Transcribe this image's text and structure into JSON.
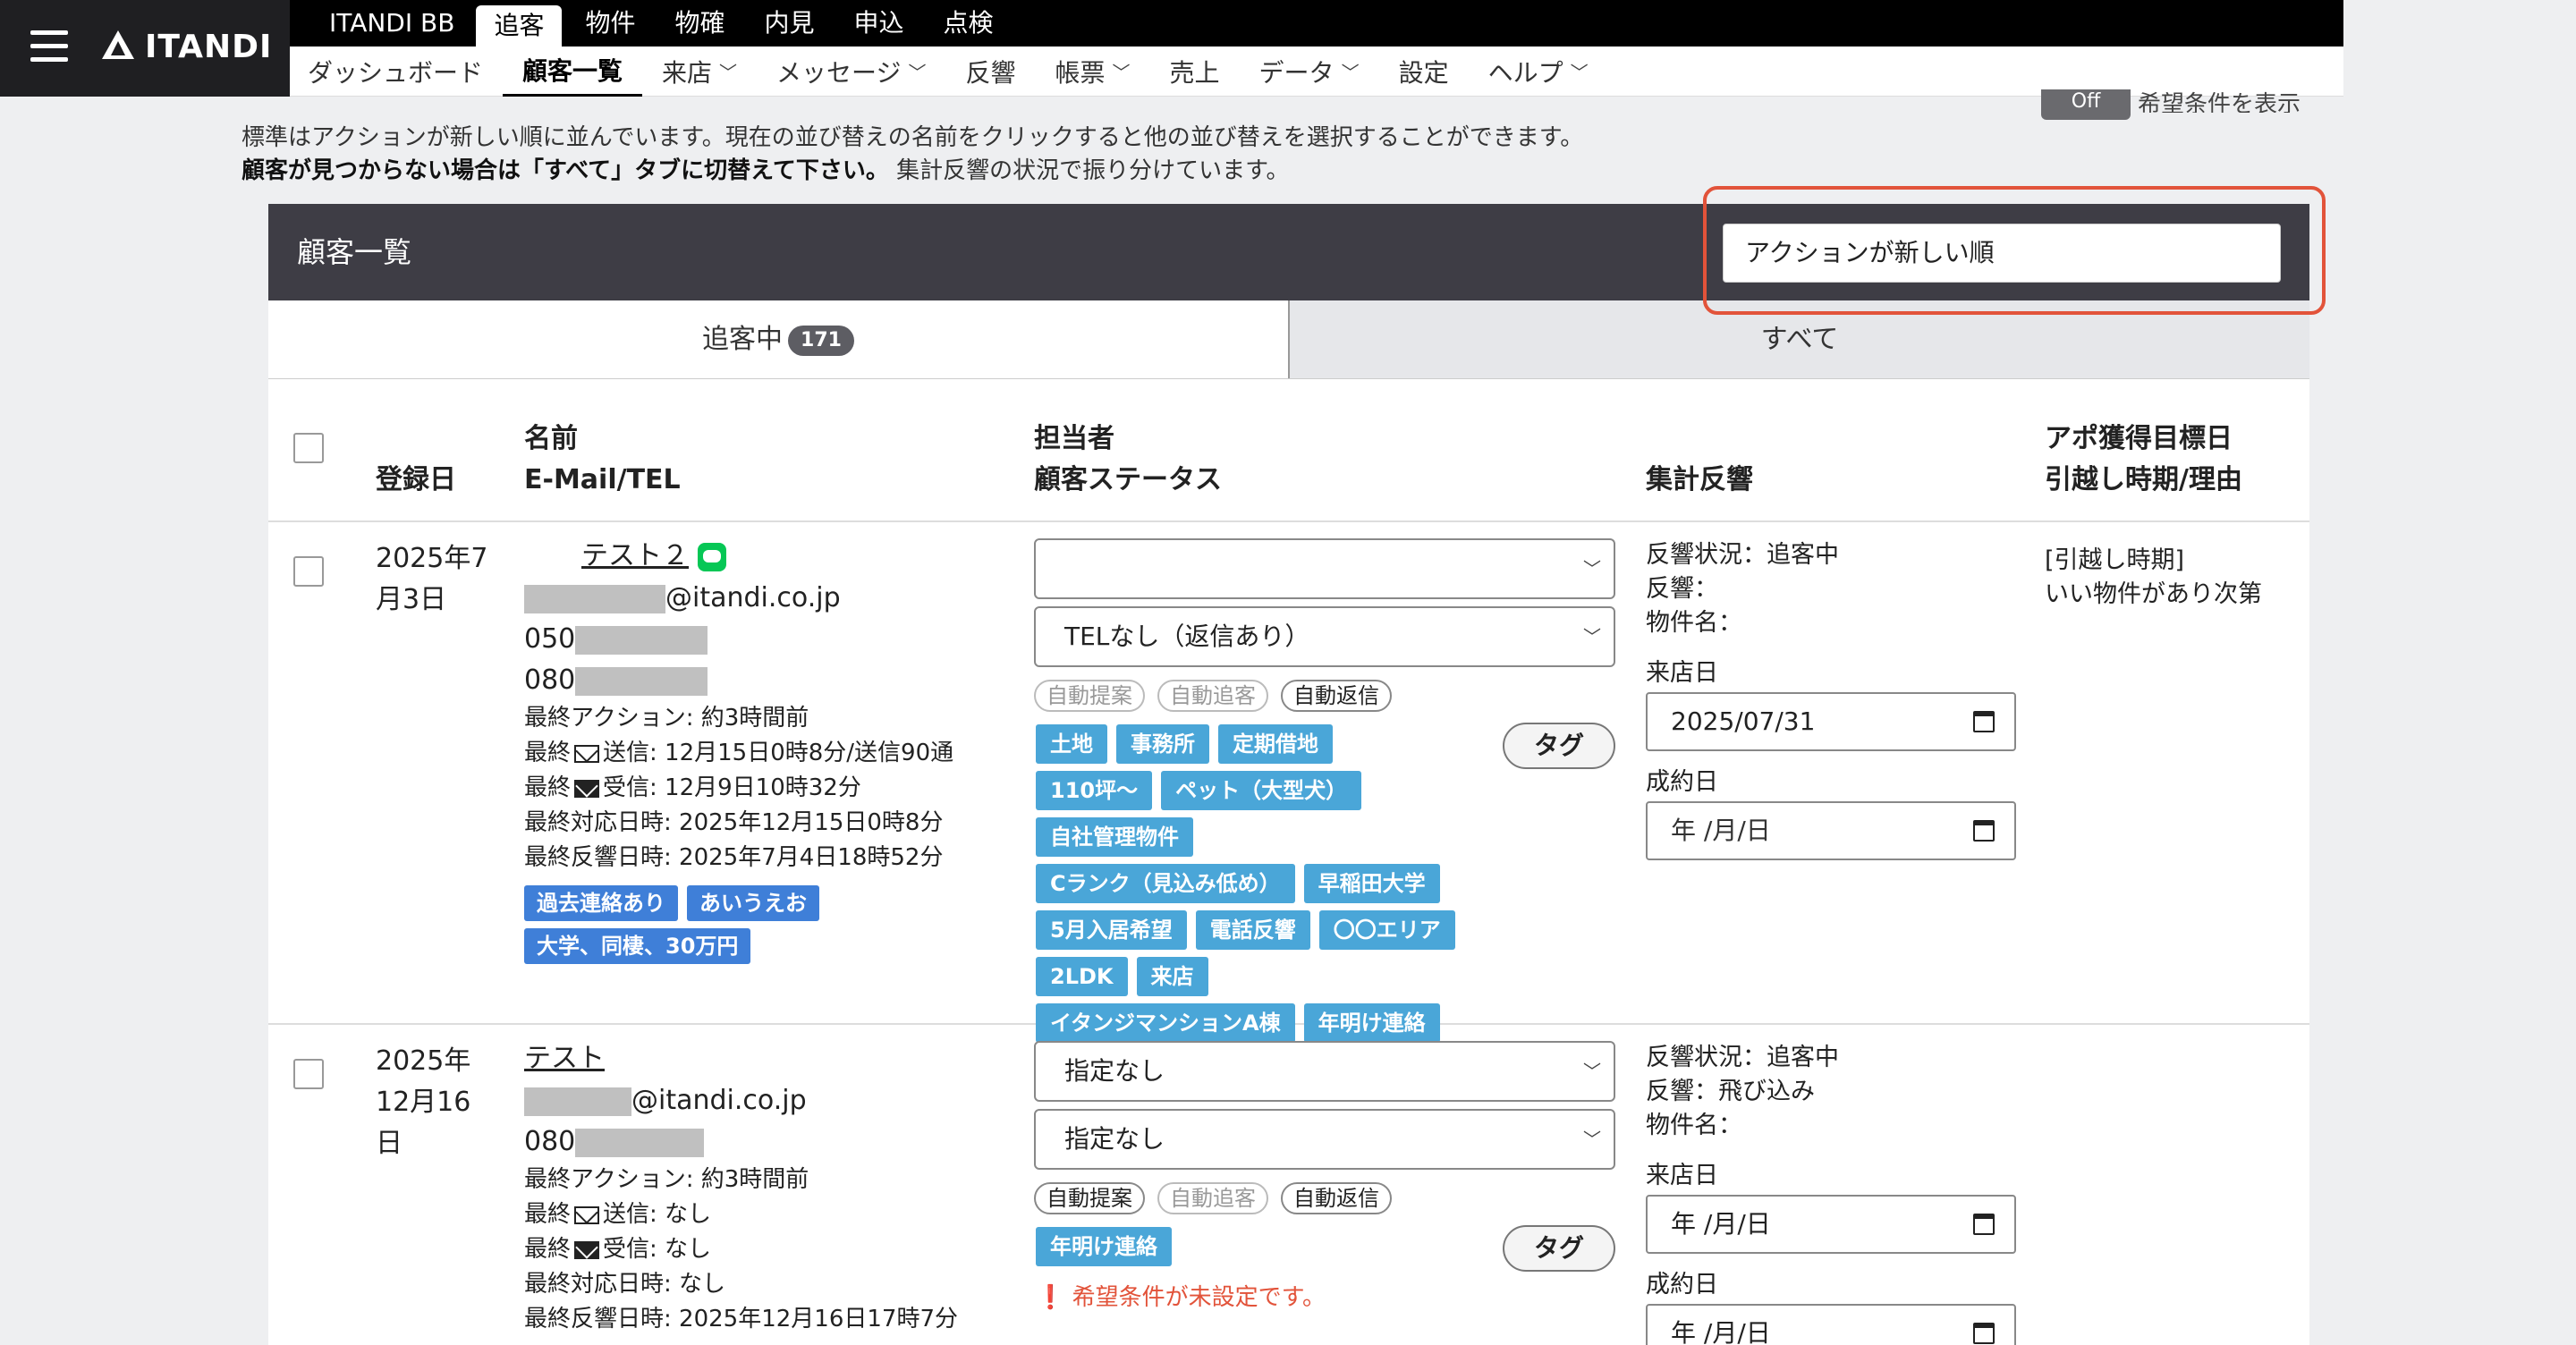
{
  "brand": {
    "logo_text": "ITANDI"
  },
  "nav_primary": [
    "ITANDI BB",
    "追客",
    "物件",
    "物確",
    "内見",
    "申込",
    "点検"
  ],
  "nav_secondary": [
    {
      "label": "ダッシュボード",
      "dropdown": false
    },
    {
      "label": "顧客一覧",
      "dropdown": false,
      "active": true
    },
    {
      "label": "来店",
      "dropdown": true
    },
    {
      "label": "メッセージ",
      "dropdown": true
    },
    {
      "label": "反響",
      "dropdown": false
    },
    {
      "label": "帳票",
      "dropdown": true
    },
    {
      "label": "売上",
      "dropdown": false
    },
    {
      "label": "データ",
      "dropdown": true
    },
    {
      "label": "設定",
      "dropdown": false
    },
    {
      "label": "ヘルプ",
      "dropdown": true
    }
  ],
  "toggle": {
    "state": "Off",
    "label": "希望条件を表示"
  },
  "info": {
    "line1": "標準はアクションが新しい順に並んでいます。現在の並び替えの名前をクリックすると他の並び替えを選択することができます。",
    "line2_bold": "顧客が見つからない場合は「すべて」タブに切替えて下さい。",
    "line2_rest": "集計反響の状況で振り分けています。"
  },
  "panel": {
    "title": "顧客一覧",
    "sort_value": "アクションが新しい順"
  },
  "tabs": {
    "tracking_label": "追客中",
    "tracking_count": "171",
    "all_label": "すべて"
  },
  "columns": {
    "reg_date": "登録日",
    "name": "名前",
    "email_tel": "E-Mail/TEL",
    "assignee": "担当者",
    "status": "顧客ステータス",
    "response": "集計反響",
    "appointment": "アポ獲得目標日",
    "move": "引越し時期/理由"
  },
  "rows": [
    {
      "reg_date": "2025年7\n月3日",
      "name": "テスト２",
      "email_suffix": "@itandi.co.jp",
      "tel1_prefix": "050",
      "tel2_prefix": "080",
      "last_action": "最終アクション: 約3時間前",
      "last_sent_pre": "最終",
      "last_sent": "送信: 12月15日0時8分/送信90通",
      "last_recv_pre": "最終",
      "last_recv": "受信: 12月9日10時32分",
      "last_reply": "最終対応日時: 2025年12月15日0時8分",
      "last_resp": "最終反響日時: 2025年7月4日18時52分",
      "labels": [
        "過去連絡あり",
        "あいうえお",
        "大学、同棲、30万円"
      ],
      "assignee": "",
      "status": "TELなし（返信あり）",
      "auto_flags": [
        "自動提案",
        "自動追客",
        "自動返信"
      ],
      "tags": [
        "土地",
        "事務所",
        "定期借地",
        "110坪〜",
        "ペット（大型犬）",
        "自社管理物件",
        "Cランク（見込み低め）",
        "早稲田大学",
        "5月入居希望",
        "電話反響",
        "〇〇エリア",
        "2LDK",
        "来店",
        "イタンジマンションA棟",
        "年明け連絡"
      ],
      "tag_button": "タグ",
      "resp_status": "反響状況：追客中",
      "resp": "反響：",
      "property": "物件名：",
      "visit_label": "来店日",
      "visit_date": "2025/07/31",
      "contract_label": "成約日",
      "contract_date": "年 /月/日",
      "move_time": "[引越し時期]",
      "move_reason": "いい物件があり次第"
    },
    {
      "reg_date": "2025年\n12月16\n日",
      "name": "テスト",
      "email_suffix": "@itandi.co.jp",
      "tel1_prefix": "080",
      "last_action": "最終アクション: 約3時間前",
      "last_sent_pre": "最終",
      "last_sent": "送信: なし",
      "last_recv_pre": "最終",
      "last_recv": "受信: なし",
      "last_reply": "最終対応日時: なし",
      "last_resp": "最終反響日時: 2025年12月16日17時7分",
      "assignee": "指定なし",
      "status": "指定なし",
      "auto_flags": [
        "自動提案",
        "自動追客",
        "自動返信"
      ],
      "tags": [
        "年明け連絡"
      ],
      "tag_button": "タグ",
      "warning": "希望条件が未設定です。",
      "resp_status": "反響状況：追客中",
      "resp": "反響：飛び込み",
      "property": "物件名：",
      "visit_label": "来店日",
      "visit_date": "年 /月/日",
      "contract_label": "成約日",
      "contract_date": "年 /月/日"
    }
  ]
}
